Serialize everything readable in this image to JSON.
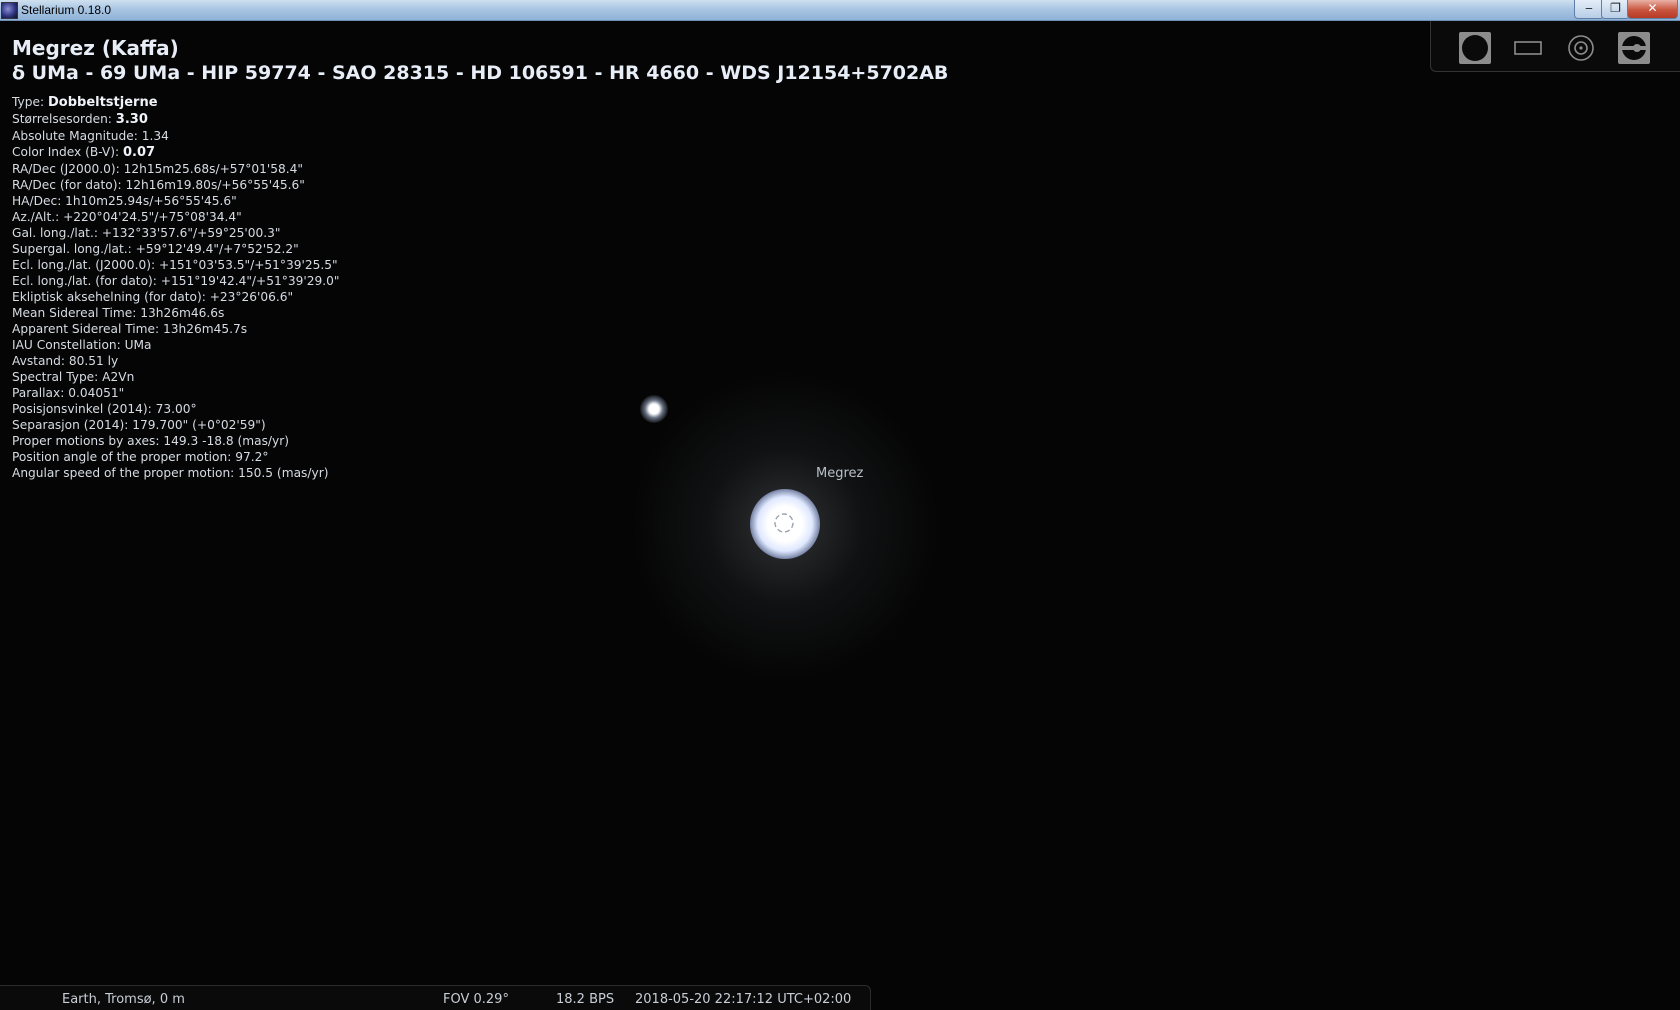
{
  "window": {
    "title": "Stellarium 0.18.0",
    "minimize_glyph": "‒",
    "maximize_glyph": "❐",
    "close_glyph": "✕"
  },
  "info": {
    "name": "Megrez (Kaffa)",
    "designations": "δ UMa - 69 UMa - HIP 59774 - SAO 28315 - HD 106591 - HR 4660 - WDS J12154+5702AB",
    "rows": [
      {
        "label": "Type: ",
        "value": "Dobbeltstjerne",
        "bold": true
      },
      {
        "label": "Størrelsesorden: ",
        "value": "3.30",
        "bold": true
      },
      {
        "label": "Absolute Magnitude: ",
        "value": "1.34",
        "bold": false
      },
      {
        "label": "Color Index (B-V): ",
        "value": "0.07",
        "bold": true
      },
      {
        "label": "RA/Dec (J2000.0): ",
        "value": "12h15m25.68s/+57°01'58.4\"",
        "bold": false
      },
      {
        "label": "RA/Dec (for dato): ",
        "value": "12h16m19.80s/+56°55'45.6\"",
        "bold": false
      },
      {
        "label": "HA/Dec: ",
        "value": "1h10m25.94s/+56°55'45.6\"",
        "bold": false
      },
      {
        "label": "Az./Alt.: ",
        "value": "+220°04'24.5\"/+75°08'34.4\"",
        "bold": false
      },
      {
        "label": "Gal. long./lat.: ",
        "value": "+132°33'57.6\"/+59°25'00.3\"",
        "bold": false
      },
      {
        "label": "Supergal. long./lat.: ",
        "value": "+59°12'49.4\"/+7°52'52.2\"",
        "bold": false
      },
      {
        "label": "Ecl. long./lat. (J2000.0): ",
        "value": "+151°03'53.5\"/+51°39'25.5\"",
        "bold": false
      },
      {
        "label": "Ecl. long./lat. (for dato): ",
        "value": "+151°19'42.4\"/+51°39'29.0\"",
        "bold": false
      },
      {
        "label": "Ekliptisk aksehelning (for dato): ",
        "value": "+23°26'06.6\"",
        "bold": false
      },
      {
        "label": "Mean Sidereal Time: ",
        "value": "13h26m46.6s",
        "bold": false
      },
      {
        "label": "Apparent Sidereal Time: ",
        "value": "13h26m45.7s",
        "bold": false
      },
      {
        "label": "IAU Constellation: ",
        "value": "UMa",
        "bold": false
      },
      {
        "label": "Avstand: ",
        "value": "80.51 ly",
        "bold": false
      },
      {
        "label": "Spectral Type: ",
        "value": "A2Vn",
        "bold": false
      },
      {
        "label": "Parallax: ",
        "value": "0.04051\"",
        "bold": false
      },
      {
        "label": "Posisjonsvinkel (2014): ",
        "value": "73.00°",
        "bold": false
      },
      {
        "label": "Separasjon (2014): ",
        "value": "179.700\" (+0°02'59\")",
        "bold": false
      },
      {
        "label": "Proper motions by axes: ",
        "value": "149.3 -18.8 (mas/yr)",
        "bold": false
      },
      {
        "label": "Position angle of the proper motion: ",
        "value": "97.2°",
        "bold": false
      },
      {
        "label": "Angular speed of the proper motion: ",
        "value": "150.5 (mas/yr)",
        "bold": false
      }
    ]
  },
  "sky": {
    "star_label": "Megrez"
  },
  "status": {
    "location": "Earth, Tromsø, 0 m",
    "fov": "FOV 0.29°",
    "fps": "18.2 BPS",
    "datetime": "2018-05-20 22:17:12 UTC+02:00"
  },
  "toolbar": {
    "buttons": [
      "planet-icon",
      "ocular-frame-icon",
      "telrad-icon",
      "configuration-icon"
    ]
  }
}
